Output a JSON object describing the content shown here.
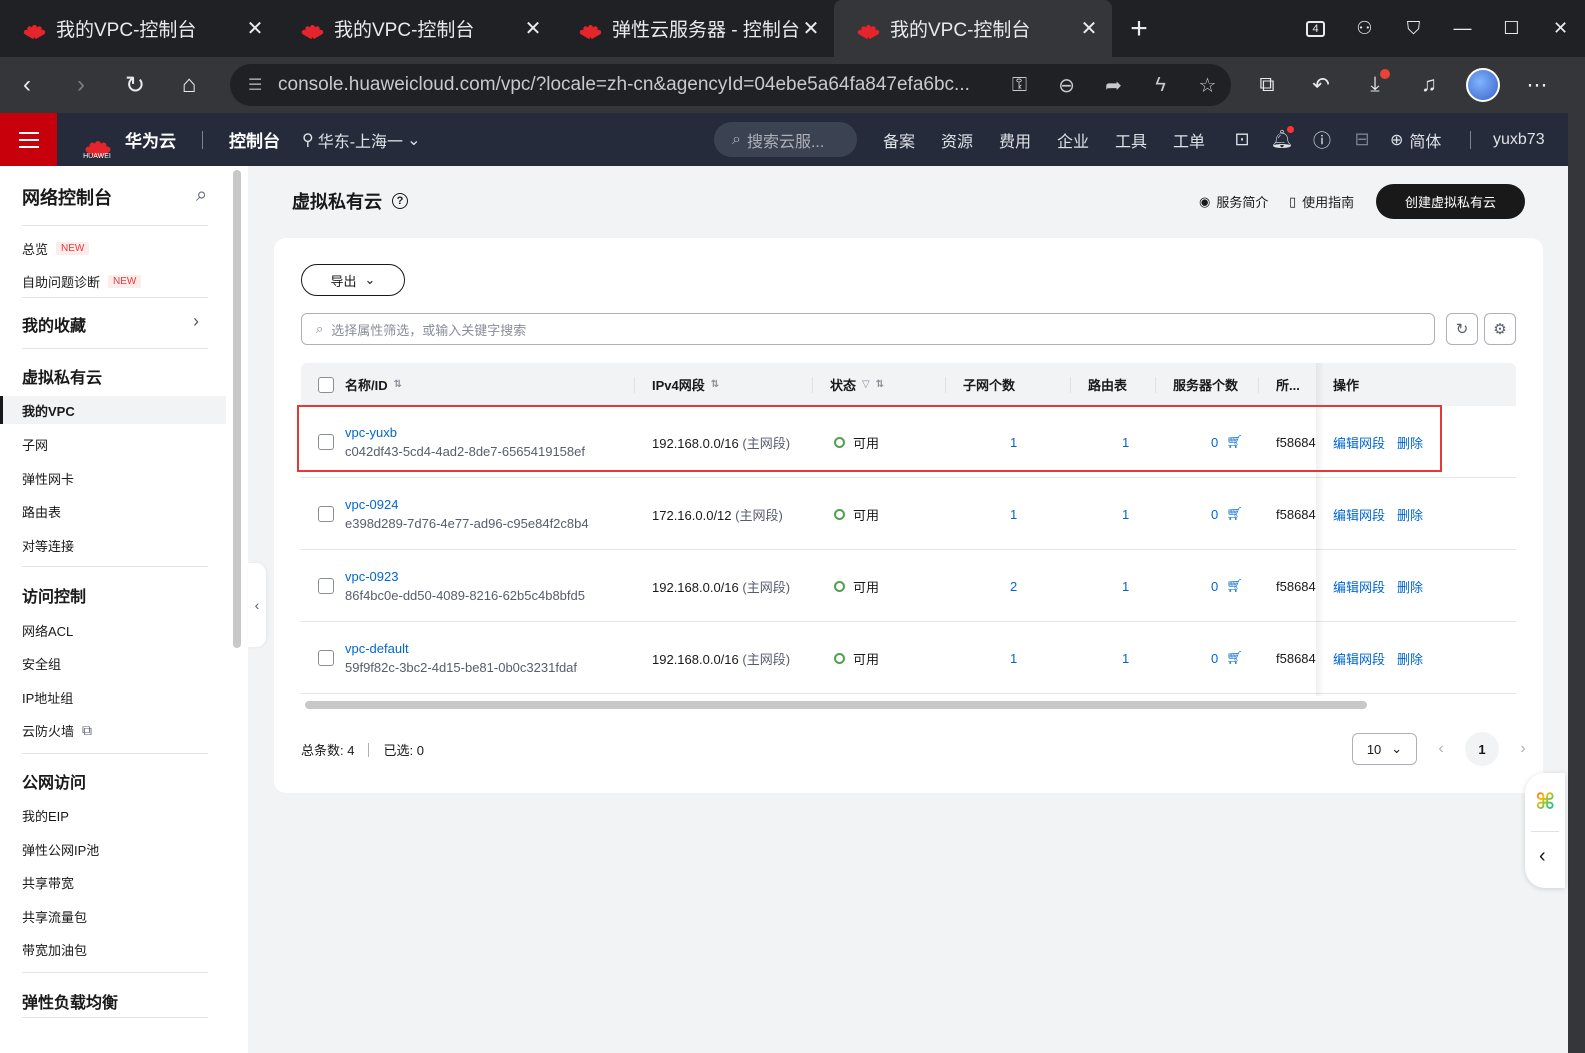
{
  "browser": {
    "tabs": [
      {
        "title": "我的VPC-控制台",
        "active": false
      },
      {
        "title": "我的VPC-控制台",
        "active": false
      },
      {
        "title": "弹性云服务器 - 控制台",
        "active": false
      },
      {
        "title": "我的VPC-控制台",
        "active": true
      }
    ],
    "tab_close": "✕",
    "new_tab": "+",
    "url": "console.huaweicloud.com/vpc/?locale=zh-cn&agencyId=04ebe5a64fa847efa6bc...",
    "tab_count_badge": "4"
  },
  "console": {
    "brand": "华为云",
    "logo_text": "HUAWEI",
    "console_label": "控制台",
    "region": "华东-上海一",
    "search_placeholder": "搜索云服...",
    "nav": [
      "备案",
      "资源",
      "费用",
      "企业",
      "工具",
      "工单"
    ],
    "lang": "简体",
    "user": "yuxb73"
  },
  "sidebar": {
    "title": "网络控制台",
    "overview": "总览",
    "self_diag": "自助问题诊断",
    "new_badge": "NEW",
    "favorites": "我的收藏",
    "groups": [
      {
        "title": "虚拟私有云",
        "items": [
          "我的VPC",
          "子网",
          "弹性网卡",
          "路由表",
          "对等连接"
        ]
      },
      {
        "title": "访问控制",
        "items": [
          "网络ACL",
          "安全组",
          "IP地址组",
          "云防火墙"
        ]
      },
      {
        "title": "公网访问",
        "items": [
          "我的EIP",
          "弹性公网IP池",
          "共享带宽",
          "共享流量包",
          "带宽加油包"
        ]
      },
      {
        "title": "弹性负载均衡",
        "items": []
      }
    ]
  },
  "page": {
    "title": "虚拟私有云",
    "service_intro": "服务简介",
    "user_guide": "使用指南",
    "create_button": "创建虚拟私有云",
    "export_button": "导出",
    "filter_placeholder": "选择属性筛选，或输入关键字搜索"
  },
  "table": {
    "headers": {
      "name": "名称/ID",
      "cidr": "IPv4网段",
      "status": "状态",
      "subnets": "子网个数",
      "routes": "路由表",
      "servers": "服务器个数",
      "project": "所...",
      "ops": "操作"
    },
    "rows": [
      {
        "name": "vpc-yuxb",
        "id": "c042df43-5cd4-4ad2-8de7-6565419158ef",
        "cidr": "192.168.0.0/16",
        "cidr_tag": "(主网段)",
        "status": "可用",
        "subnets": "1",
        "routes": "1",
        "servers": "0",
        "project": "f58684",
        "op_edit": "编辑网段",
        "op_delete": "删除"
      },
      {
        "name": "vpc-0924",
        "id": "e398d289-7d76-4e77-ad96-c95e84f2c8b4",
        "cidr": "172.16.0.0/12",
        "cidr_tag": "(主网段)",
        "status": "可用",
        "subnets": "1",
        "routes": "1",
        "servers": "0",
        "project": "f58684",
        "op_edit": "编辑网段",
        "op_delete": "删除"
      },
      {
        "name": "vpc-0923",
        "id": "86f4bc0e-dd50-4089-8216-62b5c4b8bfd5",
        "cidr": "192.168.0.0/16",
        "cidr_tag": "(主网段)",
        "status": "可用",
        "subnets": "2",
        "routes": "1",
        "servers": "0",
        "project": "f58684",
        "op_edit": "编辑网段",
        "op_delete": "删除"
      },
      {
        "name": "vpc-default",
        "id": "59f9f82c-3bc2-4d15-be81-0b0c3231fdaf",
        "cidr": "192.168.0.0/16",
        "cidr_tag": "(主网段)",
        "status": "可用",
        "subnets": "1",
        "routes": "1",
        "servers": "0",
        "project": "f58684",
        "op_edit": "编辑网段",
        "op_delete": "删除"
      }
    ]
  },
  "footer": {
    "total_label": "总条数:",
    "total": "4",
    "selected_label": "已选:",
    "selected": "0",
    "page_size": "10",
    "current_page": "1"
  },
  "colors": {
    "brand_red": "#c7000b",
    "link_blue": "#0067d1",
    "status_green": "#50a14f",
    "highlight_red": "#e53935"
  }
}
